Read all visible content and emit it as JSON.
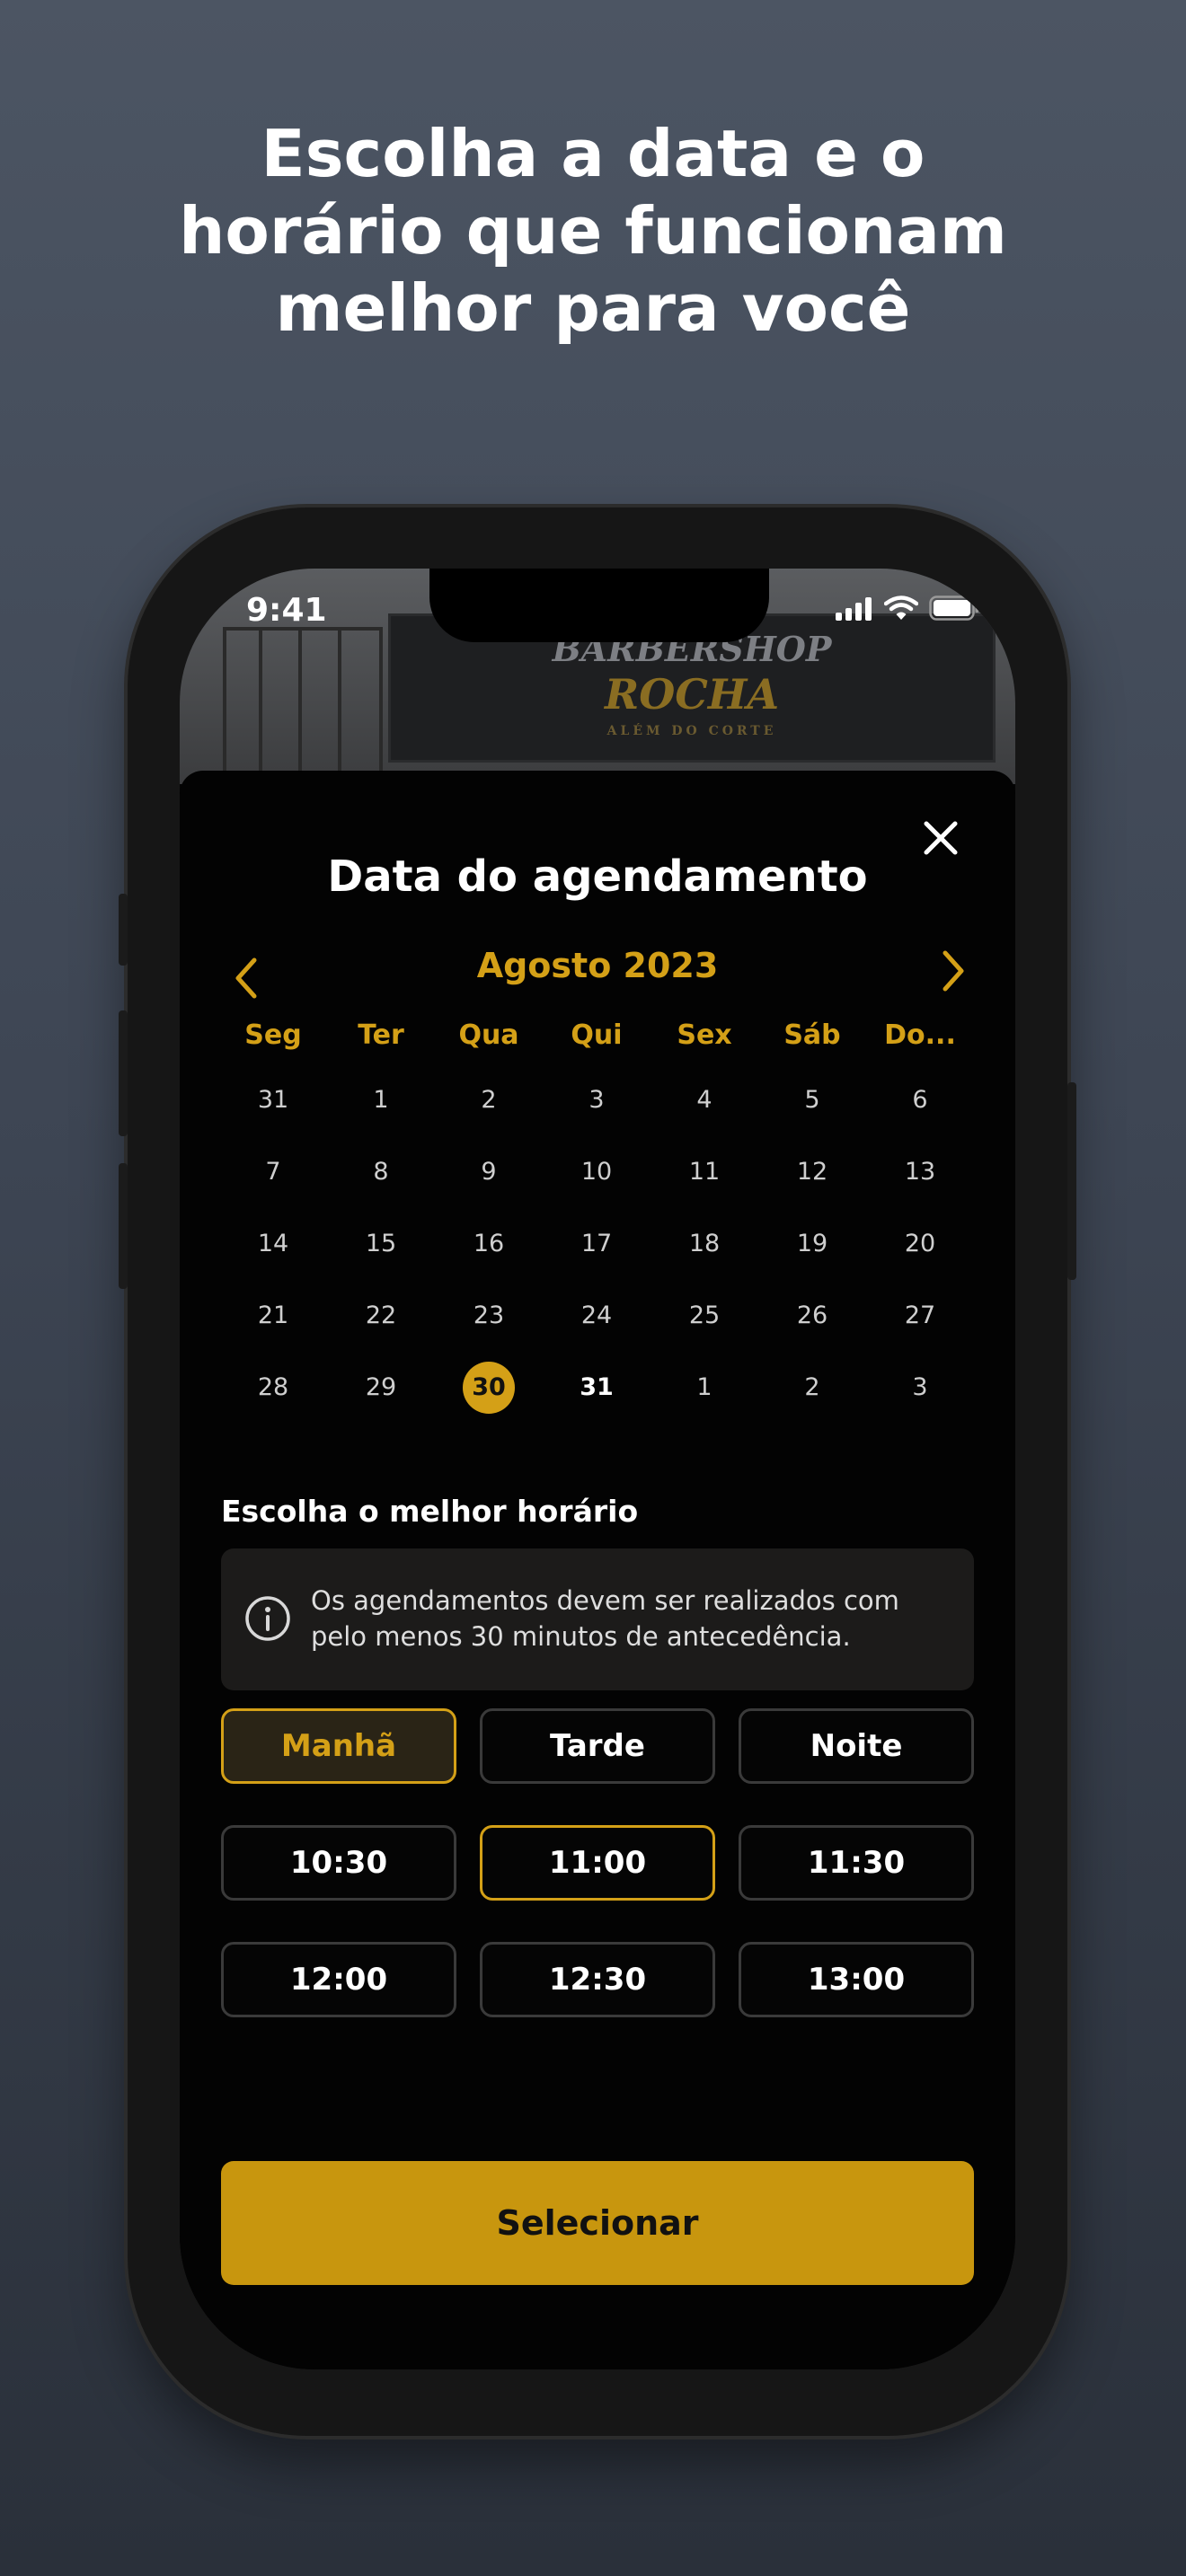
{
  "headline": {
    "line1": "Escolha a data e o",
    "line2": "horário que funcionam",
    "line3": "melhor para você"
  },
  "status_bar": {
    "time": "9:41"
  },
  "background_sign": {
    "line1": "BARBERSHOP",
    "line2": "ROCHA",
    "line3": "ALÉM DO CORTE"
  },
  "sheet": {
    "title": "Data do agendamento",
    "month_label": "Agosto 2023"
  },
  "calendar": {
    "weekdays": [
      "Seg",
      "Ter",
      "Qua",
      "Qui",
      "Sex",
      "Sáb",
      "Do..."
    ],
    "weeks": [
      [
        "31",
        "1",
        "2",
        "3",
        "4",
        "5",
        "6"
      ],
      [
        "7",
        "8",
        "9",
        "10",
        "11",
        "12",
        "13"
      ],
      [
        "14",
        "15",
        "16",
        "17",
        "18",
        "19",
        "20"
      ],
      [
        "21",
        "22",
        "23",
        "24",
        "25",
        "26",
        "27"
      ],
      [
        "28",
        "29",
        "30",
        "31",
        "1",
        "2",
        "3"
      ]
    ],
    "selected_day": "30"
  },
  "time_section": {
    "title": "Escolha o melhor horário",
    "info_text": "Os agendamentos devem ser realizados com pelo menos 30 minutos de antecedência."
  },
  "periods": [
    "Manhã",
    "Tarde",
    "Noite"
  ],
  "selected_period": "Manhã",
  "times": [
    [
      "10:30",
      "11:00",
      "11:30"
    ],
    [
      "12:00",
      "12:30",
      "13:00"
    ]
  ],
  "selected_time": "11:00",
  "select_button": "Selecionar",
  "colors": {
    "accent": "#d4a017",
    "button": "#c8960e",
    "sheet_background": "#030303"
  }
}
